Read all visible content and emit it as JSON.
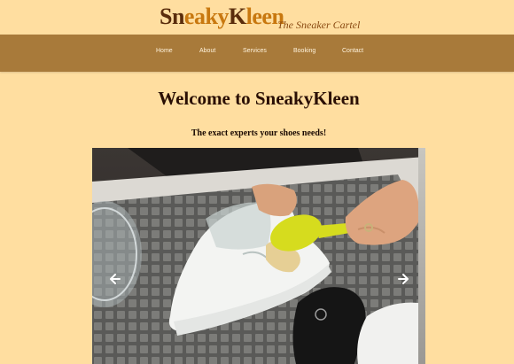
{
  "logo": {
    "part1": "Sn",
    "part2": "eaky",
    "part3": "K",
    "part4": "leen",
    "tagline": "The Sneaker Cartel"
  },
  "nav": {
    "items": [
      {
        "label": "Home"
      },
      {
        "label": "About"
      },
      {
        "label": "Services"
      },
      {
        "label": "Booking"
      },
      {
        "label": "Contact"
      }
    ]
  },
  "main": {
    "title": "Welcome to SneakyKleen",
    "subtitle": "The exact experts your shoes needs!"
  },
  "carousel": {
    "image_subject": "hands cleaning a white sneaker with a yellow brush",
    "prev_icon": "arrow-left-icon",
    "next_icon": "arrow-right-icon"
  },
  "colors": {
    "page_bg": "#ffdea0",
    "nav_bg": "#a87a3a",
    "logo_dark": "#5a2d0c",
    "logo_accent": "#c8780f"
  }
}
